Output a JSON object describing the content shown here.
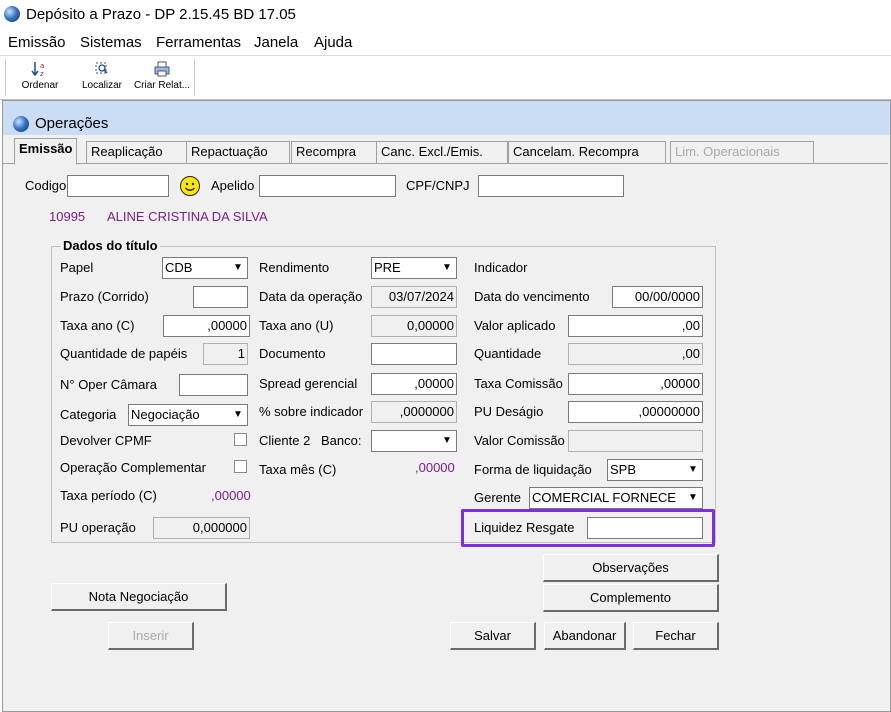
{
  "app": {
    "title": "Depósito a Prazo -  DP 2.15.45 BD 17.05"
  },
  "menu": [
    "Emissão",
    "Sistemas",
    "Ferramentas",
    "Janela",
    "Ajuda"
  ],
  "toolbar": {
    "ordenar": "Ordenar",
    "localizar": "Localizar",
    "criar": "Criar Relat..."
  },
  "window": {
    "title": "Operações"
  },
  "tabs": [
    "Emissão",
    "Reaplicação",
    "Repactuação",
    "Recompra",
    "Canc. Excl./Emis.",
    "Cancelam. Recompra",
    "Lim. Operacionais"
  ],
  "header": {
    "codigo_label": "Codigo",
    "codigo_value": "",
    "apelido_label": "Apelido",
    "apelido_value": "",
    "cpf_label": "CPF/CNPJ",
    "cpf_value": "",
    "client_code": "10995",
    "client_name": "ALINE CRISTINA DA SILVA"
  },
  "group": {
    "title": "Dados do título",
    "papel_label": "Papel",
    "papel_value": "CDB",
    "prazo_label": "Prazo (Corrido)",
    "prazo_value": "",
    "taxa_c_label": "Taxa ano (C)",
    "taxa_c_value": ",00000",
    "qtd_papeis_label": "Quantidade de papéis",
    "qtd_papeis_value": "1",
    "oper_camara_label": "N° Oper Câmara",
    "oper_camara_value": "",
    "categoria_label": "Categoria",
    "categoria_value": "Negociação",
    "cpmf_label": "Devolver CPMF",
    "complementar_label": "Operação Complementar",
    "taxa_periodo_label": "Taxa período (C)",
    "taxa_periodo_value": ",00000",
    "pu_operacao_label": "PU operação",
    "pu_operacao_value": "0,000000",
    "rendimento_label": "Rendimento",
    "rendimento_value": "PRE",
    "data_oper_label": "Data da operação",
    "data_oper_value": "03/07/2024",
    "taxa_u_label": "Taxa ano (U)",
    "taxa_u_value": "0,00000",
    "documento_label": "Documento",
    "documento_value": "",
    "spread_label": "Spread gerencial",
    "spread_value": ",00000",
    "pct_indicador_label": "% sobre indicador",
    "pct_indicador_value": ",0000000",
    "cliente2_label": "Cliente 2",
    "banco_label": "Banco:",
    "banco_value": "",
    "taxa_mes_label": "Taxa mês (C)",
    "taxa_mes_value": ",00000",
    "indicador_label": "Indicador",
    "vencimento_label": "Data do vencimento",
    "vencimento_value": "00/00/0000",
    "valor_aplicado_label": "Valor aplicado",
    "valor_aplicado_value": ",00",
    "quantidade_label": "Quantidade",
    "quantidade_value": ",00",
    "taxa_comissao_label": "Taxa Comissão",
    "taxa_comissao_value": ",00000",
    "pu_desagio_label": "PU Deságio",
    "pu_desagio_value": ",00000000",
    "valor_comissao_label": "Valor Comissão",
    "valor_comissao_value": "",
    "forma_liq_label": "Forma de liquidação",
    "forma_liq_value": "SPB",
    "gerente_label": "Gerente",
    "gerente_value": "COMERCIAL FORNECE",
    "liquidez_label": "Liquidez Resgate",
    "liquidez_value": ""
  },
  "buttons": {
    "observacoes": "Observações",
    "complemento": "Complemento",
    "nota": "Nota Negociação",
    "inserir": "Inserir",
    "salvar": "Salvar",
    "abandonar": "Abandonar",
    "fechar": "Fechar"
  },
  "colors": {
    "highlight": "#7b2fe0",
    "client_text": "#7a1f86",
    "window_title_bg": "#cbdcf5"
  },
  "icons": [
    "app-logo-icon",
    "sort-az-icon",
    "find-icon",
    "print-report-icon",
    "smiley-search-icon",
    "dropdown-arrow-icon"
  ]
}
